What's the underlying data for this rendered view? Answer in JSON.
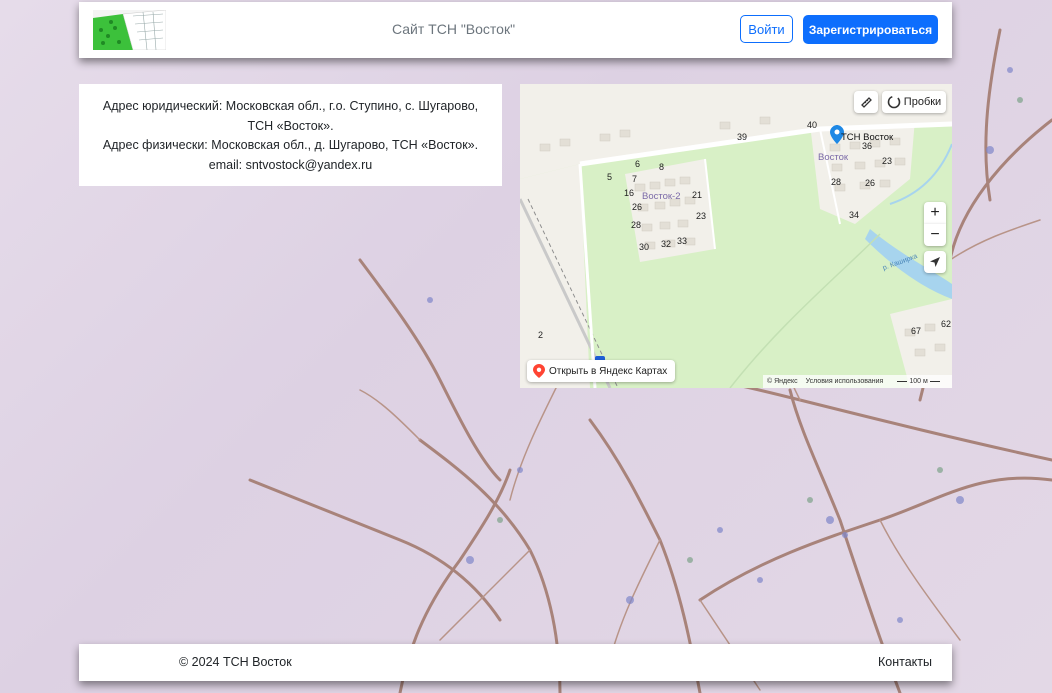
{
  "header": {
    "title": "Сайт ТСН \"Восток\"",
    "login_label": "Войти",
    "register_label": "Зарегистрироваться"
  },
  "address": {
    "legal": "Адрес юридический: Московская обл., г.о. Ступино, с. Шугарово, ТСН «Восток».",
    "physical": "Адрес физически: Московская обл., д. Шугарово, ТСН «Восток».",
    "email": "email: sntvostock@yandex.ru"
  },
  "map": {
    "traffic_label": "Пробки",
    "open_label": "Открыть в Яндекс Картах",
    "pin_label": "ТСН Восток",
    "area_label_1": "Восток-2",
    "area_label_2": "Восток",
    "river_label": "р. Каширка",
    "copyright": "© Яндекс",
    "terms": "Условия использования",
    "scale": "100 м",
    "house_numbers": [
      "39",
      "40",
      "6",
      "8",
      "5",
      "7",
      "16",
      "26",
      "21",
      "23",
      "28",
      "30",
      "32",
      "33",
      "36",
      "23",
      "28",
      "26",
      "34",
      "2",
      "67",
      "62"
    ],
    "zoom_in": "+",
    "zoom_out": "−"
  },
  "footer": {
    "copyright": "© 2024 ТСН Восток",
    "contacts_label": "Контакты"
  },
  "colors": {
    "primary": "#0d6efd",
    "park": "#d8f0c6",
    "background": "#e6dcea"
  }
}
